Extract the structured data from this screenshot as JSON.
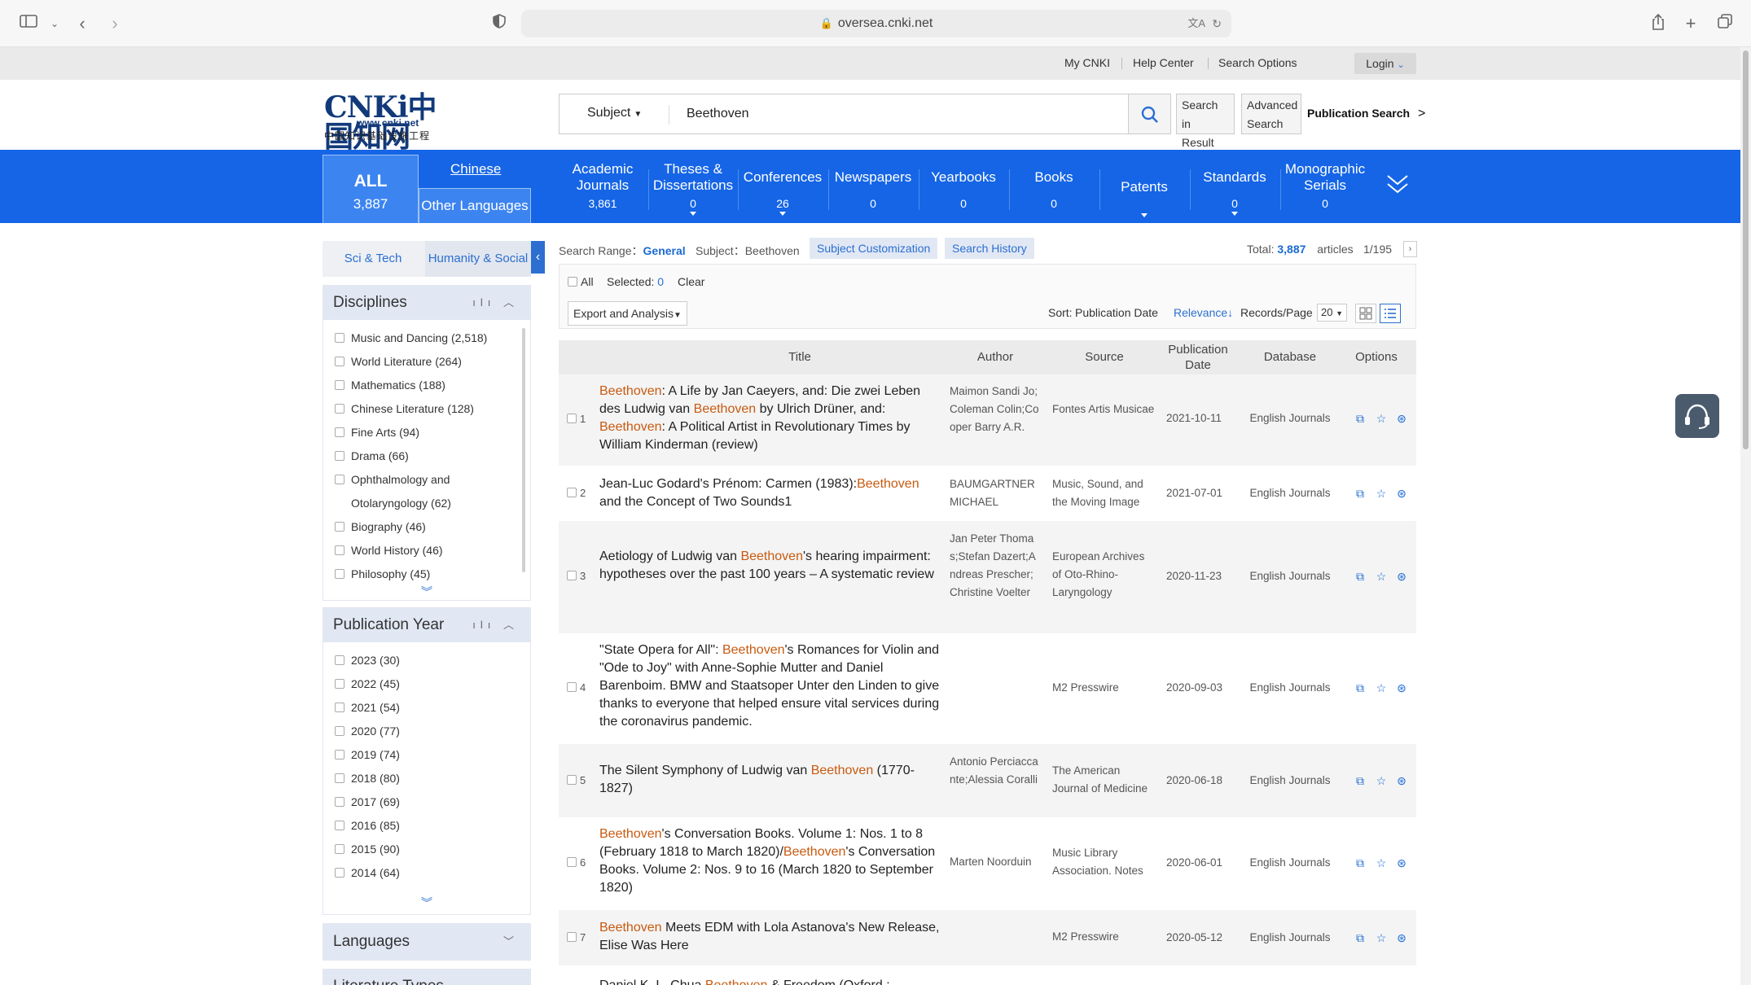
{
  "browser": {
    "url": "oversea.cnki.net"
  },
  "topnav": {
    "my_cnki": "My CNKI",
    "help_center": "Help Center",
    "search_options": "Search Options",
    "login": "Login"
  },
  "logo": {
    "mark": "CNKi中国知网",
    "url": "www.cnki.net",
    "tagline": "中国知识基础设施工程"
  },
  "search": {
    "field": "Subject",
    "value": "Beethoven",
    "search_in_result_1": "Search in",
    "search_in_result_2": "Result",
    "advanced_1": "Advanced",
    "advanced_2": "Search",
    "publication_search": "Publication Search",
    "publication_search_arrow": ">"
  },
  "categories": {
    "all_label": "ALL",
    "all_count": "3,887",
    "chinese": "Chinese",
    "other_languages": "Other Languages",
    "items": [
      {
        "label1": "Academic",
        "label2": "Journals",
        "count": "3,861"
      },
      {
        "label1": "Theses &",
        "label2": "Dissertations",
        "count": "0"
      },
      {
        "label1": "Conferences",
        "label2": "",
        "count": "26"
      },
      {
        "label1": "Newspapers",
        "label2": "",
        "count": "0"
      },
      {
        "label1": "Yearbooks",
        "label2": "",
        "count": "0"
      },
      {
        "label1": "Books",
        "label2": "",
        "count": "0"
      },
      {
        "label1": "Patents",
        "label2": "",
        "count": ""
      },
      {
        "label1": "Standards",
        "label2": "",
        "count": "0"
      },
      {
        "label1": "Monographic",
        "label2": "Serials",
        "count": "0"
      }
    ]
  },
  "sidebar": {
    "tab_scitech": "Sci & Tech",
    "tab_humanity": "Humanity & Social",
    "disciplines": {
      "title": "Disciplines",
      "items": [
        "Music and Dancing  (2,518)",
        "World Literature  (264)",
        "Mathematics  (188)",
        "Chinese Literature  (128)",
        "Fine Arts  (94)",
        "Drama  (66)",
        "Ophthalmology and",
        "Otolaryngology  (62)",
        "Biography  (46)",
        "World History  (46)",
        "Philosophy  (45)"
      ]
    },
    "pubyear": {
      "title": "Publication Year",
      "items": [
        "2023  (30)",
        "2022  (45)",
        "2021  (54)",
        "2020  (77)",
        "2019  (74)",
        "2018  (80)",
        "2017  (69)",
        "2016  (85)",
        "2015  (90)",
        "2014  (64)"
      ]
    },
    "languages": {
      "title": "Languages"
    },
    "literature_types": {
      "title": "Literature Types"
    }
  },
  "range": {
    "label": "Search Range：",
    "value": "General",
    "subject": "Subject：Beethoven",
    "subject_customization": "Subject Customization",
    "search_history": "Search History",
    "total_label": "Total:",
    "total_value": "3,887",
    "total_unit": "articles",
    "page": "1/195"
  },
  "toolbar": {
    "all": "All",
    "selected_label": "Selected:",
    "selected_value": "0",
    "clear": "Clear",
    "export": "Export and Analysis",
    "sort_label": "Sort:",
    "sort_pubdate": "Publication Date",
    "sort_relevance": "Relevance",
    "records_label": "Records/Page",
    "records_value": "20"
  },
  "table": {
    "headers": {
      "title": "Title",
      "author": "Author",
      "source": "Source",
      "pubdate1": "Publication",
      "pubdate2": "Date",
      "database": "Database",
      "options": "Options"
    },
    "rows": [
      {
        "num": "1",
        "title_html": "<span class=\"hl\">Beethoven</span>: A Life by Jan Caeyers, and: Die zwei Leben des Ludwig van <span class=\"hl\">Beethoven</span> by Ulrich Drüner, and: <span class=\"hl\">Beethoven</span>: A Political Artist in Revolutionary Times by William Kinderman (review)",
        "author": "Maimon Sandi Jo;Coleman Colin;Cooper Barry A.R.",
        "source": "Fontes Artis Musicae",
        "date": "2021-10-11",
        "db": "English Journals"
      },
      {
        "num": "2",
        "title_html": "Jean-Luc Godard's Prénom: Carmen (1983):<span class=\"hl\">Beethoven</span> and the Concept of Two Sounds1",
        "author": "BAUMGARTNER MICHAEL",
        "source": "Music, Sound, and the Moving Image",
        "date": "2021-07-01",
        "db": "English Journals"
      },
      {
        "num": "3",
        "title_html": "Aetiology of Ludwig van <span class=\"hl\">Beethoven</span>'s hearing impairment: hypotheses over the past 100 years – A systematic review",
        "author": "Jan Peter Thomas;Stefan Dazert;Andreas Prescher;Christine Voelter",
        "source": "European Archives of Oto-Rhino-Laryngology",
        "date": "2020-11-23",
        "db": "English Journals"
      },
      {
        "num": "4",
        "title_html": "\"State Opera for All\": <span class=\"hl\">Beethoven</span>'s Romances for Violin and \"Ode to Joy\" with Anne-Sophie Mutter and Daniel Barenboim. BMW and Staatsoper Unter den Linden to give thanks to everyone that helped ensure vital services during the coronavirus pandemic.",
        "author": "",
        "source": "M2 Presswire",
        "date": "2020-09-03",
        "db": "English Journals"
      },
      {
        "num": "5",
        "title_html": "The Silent Symphony of Ludwig van <span class=\"hl\">Beethoven</span> (1770-1827)",
        "author": "Antonio Perciaccante;Alessia Coralli",
        "source": "The American Journal of Medicine",
        "date": "2020-06-18",
        "db": "English Journals"
      },
      {
        "num": "6",
        "title_html": "<span class=\"hl\">Beethoven</span>'s Conversation Books. Volume 1: Nos. 1 to 8 (February 1818 to March 1820)/<span class=\"hl\">Beethoven</span>'s Conversation Books. Volume 2: Nos. 9 to 16 (March 1820 to September 1820)",
        "author": "Marten Noorduin",
        "source": "Music Library Association. Notes",
        "date": "2020-06-01",
        "db": "English Journals"
      },
      {
        "num": "7",
        "title_html": "<span class=\"hl\">Beethoven</span> Meets EDM with Lola Astanova's New Release, Elise Was Here",
        "author": "",
        "source": "M2 Presswire",
        "date": "2020-05-12",
        "db": "English Journals"
      },
      {
        "num": "8",
        "title_html": "Daniel K. L. Chua <span class=\"hl\">Beethoven</span> & Freedom (Oxford :",
        "author": "",
        "source": "",
        "date": "",
        "db": ""
      }
    ]
  }
}
